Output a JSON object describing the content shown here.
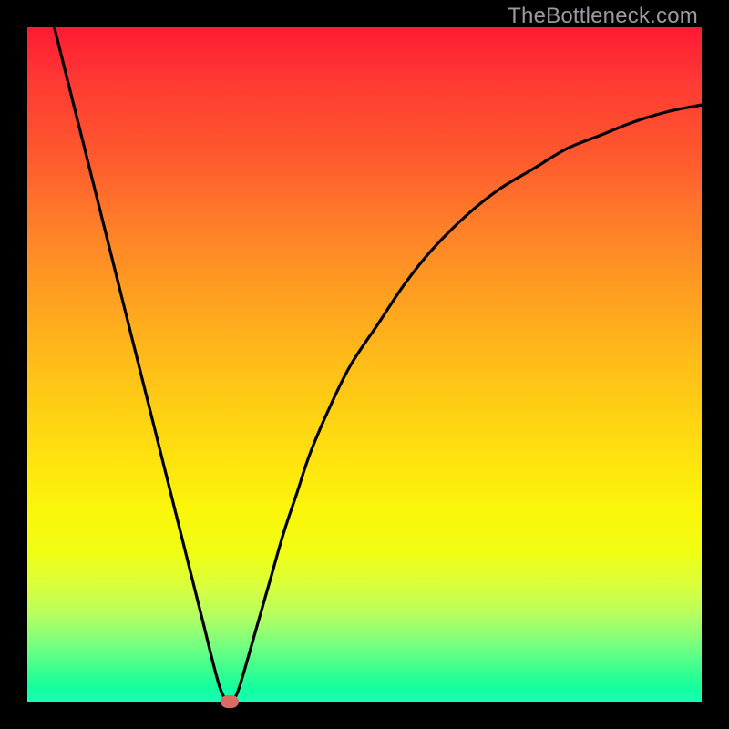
{
  "watermark": "TheBottleneck.com",
  "chart_data": {
    "type": "line",
    "title": "",
    "xlabel": "",
    "ylabel": "",
    "xlim": [
      0,
      100
    ],
    "ylim": [
      0,
      100
    ],
    "grid": false,
    "legend": false,
    "series": [
      {
        "name": "bottleneck-curve",
        "x": [
          4,
          6,
          8,
          10,
          12,
          14,
          16,
          18,
          20,
          22,
          24,
          26,
          28,
          29,
          30,
          31,
          32,
          34,
          36,
          38,
          40,
          42,
          45,
          48,
          52,
          56,
          60,
          65,
          70,
          75,
          80,
          85,
          90,
          95,
          100
        ],
        "y": [
          100,
          92,
          84,
          76,
          68,
          60,
          52,
          44,
          36,
          28,
          20,
          12,
          4,
          1,
          0,
          1,
          4,
          11,
          18,
          25,
          31,
          37,
          44,
          50,
          56,
          62,
          67,
          72,
          76,
          79,
          82,
          84,
          86,
          87.5,
          88.5
        ]
      }
    ],
    "marker": {
      "x": 30,
      "y": 0,
      "color": "#d86b63"
    },
    "gradient_colors": {
      "top": "#ff1a33",
      "mid": "#ffd313",
      "bottom": "#15ffb4"
    }
  }
}
